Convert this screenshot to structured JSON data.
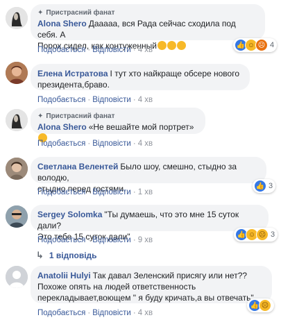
{
  "comments": [
    {
      "badge": "Пристрасний фанат",
      "author": "Alona Shero",
      "text_line1": "Дааааа, вся Рада сейчас сходила под себя. А",
      "text_line2": "Порох сидел, как контуженный",
      "like": "Подобається",
      "reply": "Відповісти",
      "time": "4 хв",
      "reaction_count": "4",
      "avatar_color": "#d8d8d8"
    },
    {
      "author": "Елена Истратова",
      "text_line1": "І тут хто найкраще обсере нового",
      "text_line2": "президента,браво.",
      "like": "Подобається",
      "reply": "Відповісти",
      "time": "4 хв",
      "avatar_color": "#9b6b4a"
    },
    {
      "badge": "Пристрасний фанат",
      "author": "Alona Shero",
      "text_line1": "«Не вешайте мой портрет»",
      "like": "Подобається",
      "reply": "Відповісти",
      "time": "4 хв",
      "avatar_color": "#d8d8d8"
    },
    {
      "author": "Светлана Велентей",
      "text_line1": "Было шоу, смешно, стыдно за володю,",
      "text_line2": "стыдно перед гостями.",
      "like": "Подобається",
      "reply": "Відповісти",
      "time": "1 хв",
      "reaction_count": "3",
      "avatar_color": "#8a7060"
    },
    {
      "author": "Sergey Solomka",
      "text_line1": "\"Ты думаешь, что это мне 15 суток дали?",
      "text_line2": "Это тебе 15 суток дали\"",
      "like": "Подобається",
      "reply": "Відповісти",
      "time": "9 хв",
      "reaction_count": "3",
      "replies_label": "1 відповідь",
      "avatar_color": "#7c8a96"
    },
    {
      "author": "Anatolii Hulyi",
      "text_line1": "Так давал Зеленский присягу или нет??",
      "text_line2": "Похоже опять на людей ответственность",
      "text_line3": "перекладывает,воющем \" я буду кричать,а вы отвечать\".",
      "like": "Подобається",
      "reply": "Відповісти",
      "time": "4 хв",
      "avatar_color": "#c9ccd1"
    }
  ]
}
